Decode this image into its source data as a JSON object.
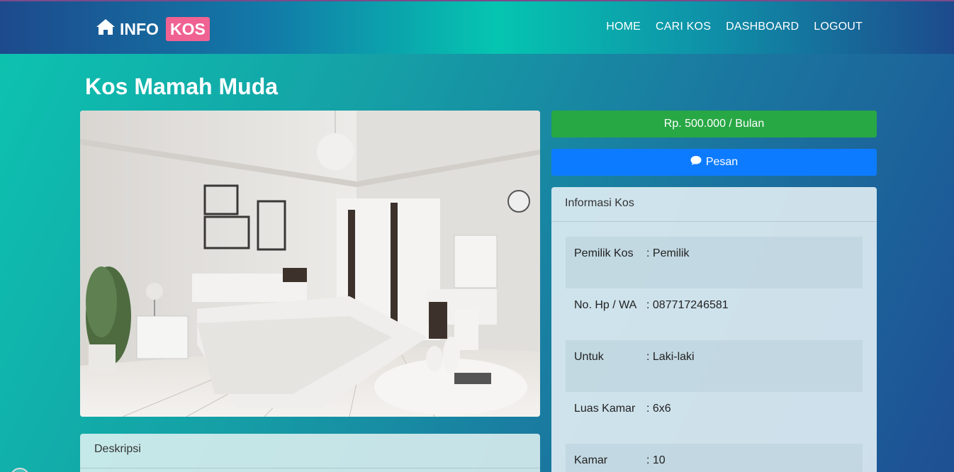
{
  "navbar": {
    "brand_info": "INFO",
    "brand_kos": "KOS",
    "links": [
      "HOME",
      "CARI KOS",
      "DASHBOARD",
      "LOGOUT"
    ]
  },
  "page_title": "Kos Mamah Muda",
  "photo": {
    "alt": "bedroom-photo"
  },
  "price_label": "Rp. 500.000 / Bulan",
  "order_label": "Pesan",
  "info": {
    "header": "Informasi Kos",
    "rows": [
      {
        "key": "Pemilik Kos",
        "value": ": Pemilik"
      },
      {
        "key": "No. Hp / WA",
        "value": ": 087717246581"
      },
      {
        "key": "Untuk",
        "value": ": Laki-laki"
      },
      {
        "key": "Luas Kamar",
        "value": ": 6x6"
      },
      {
        "key": "Kamar Kosong",
        "value": ": 10"
      }
    ]
  },
  "description": {
    "header": "Deskripsi"
  },
  "colors": {
    "price": "#28a745",
    "order": "#0d7bff",
    "brand_badge": "#f06292"
  },
  "icons": {
    "brand": "home-icon",
    "order": "chat-icon"
  }
}
